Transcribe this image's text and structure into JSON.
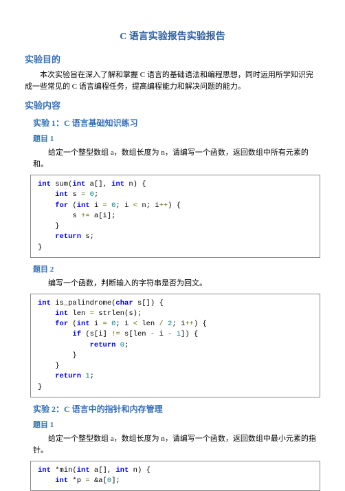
{
  "title": "C 语言实验报告实验报告",
  "purpose": {
    "heading": "实验目的",
    "text": "本次实验旨在深入了解和掌握 C 语言的基础语法和编程思想，同时运用所学知识完成一些常见的 C 语言编程任务，提高编程能力和解决问题的能力。"
  },
  "content_heading": "实验内容",
  "exp1": {
    "heading": "实验 1：C 语言基础知识练习",
    "q1_heading": "题目 1",
    "q1_text_a": "给定一个整型数组 a，数组长度为 n，请编写一个函数，返回数组中所有元素的和。",
    "q2_heading": "题目 2",
    "q2_text": "编写一个函数，判断输入的字符串是否为回文。"
  },
  "exp2": {
    "heading": "实验 2：C 语言中的指针和内存管理",
    "q1_heading": "题目 1",
    "q1_text": "给定一个整型数组 a，数组长度为 n，请编写一个函数，返回数组中最小元素的指针。"
  }
}
